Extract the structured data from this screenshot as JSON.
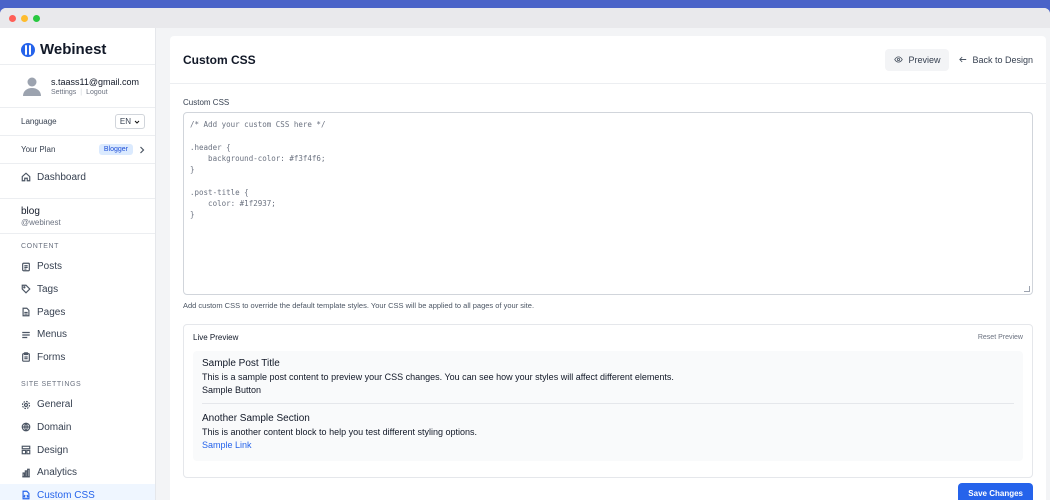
{
  "brand": {
    "name": "Webinest"
  },
  "user": {
    "email": "s.taass11@gmail.com",
    "settings": "Settings",
    "logout": "Logout"
  },
  "language": {
    "label": "Language",
    "value": "EN"
  },
  "plan": {
    "label": "Your Plan",
    "badge": "Blogger"
  },
  "nav": {
    "dashboard": "Dashboard"
  },
  "blog": {
    "name": "blog",
    "handle": "@webinest"
  },
  "content_section": {
    "label": "CONTENT",
    "items": [
      {
        "label": "Posts",
        "icon": "document-icon"
      },
      {
        "label": "Tags",
        "icon": "tag-icon"
      },
      {
        "label": "Pages",
        "icon": "page-icon"
      },
      {
        "label": "Menus",
        "icon": "menu-icon"
      },
      {
        "label": "Forms",
        "icon": "clipboard-icon"
      }
    ]
  },
  "site_settings": {
    "label": "SITE SETTINGS",
    "items": [
      {
        "label": "General",
        "icon": "gear-icon"
      },
      {
        "label": "Domain",
        "icon": "globe-icon"
      },
      {
        "label": "Design",
        "icon": "layout-icon"
      },
      {
        "label": "Analytics",
        "icon": "chart-icon"
      },
      {
        "label": "Custom CSS",
        "icon": "css-file-icon",
        "active": true
      }
    ]
  },
  "header": {
    "title": "Custom CSS",
    "preview": "Preview",
    "back": "Back to Design"
  },
  "editor": {
    "label": "Custom CSS",
    "value": "/* Add your custom CSS here */\n\n.header {\n    background-color: #f3f4f6;\n}\n\n.post-title {\n    color: #1f2937;\n}",
    "help": "Add custom CSS to override the default template styles. Your CSS will be applied to all pages of your site."
  },
  "live_preview": {
    "title": "Live Preview",
    "reset": "Reset Preview",
    "section1": {
      "title": "Sample Post Title",
      "text": "This is a sample post content to preview your CSS changes. You can see how your styles will affect different elements.",
      "button": "Sample Button"
    },
    "section2": {
      "title": "Another Sample Section",
      "text": "This is another content block to help you test different styling options.",
      "link": "Sample Link"
    }
  },
  "save": "Save Changes",
  "colors": {
    "accent": "#2563eb",
    "background": "#4a63c8"
  }
}
